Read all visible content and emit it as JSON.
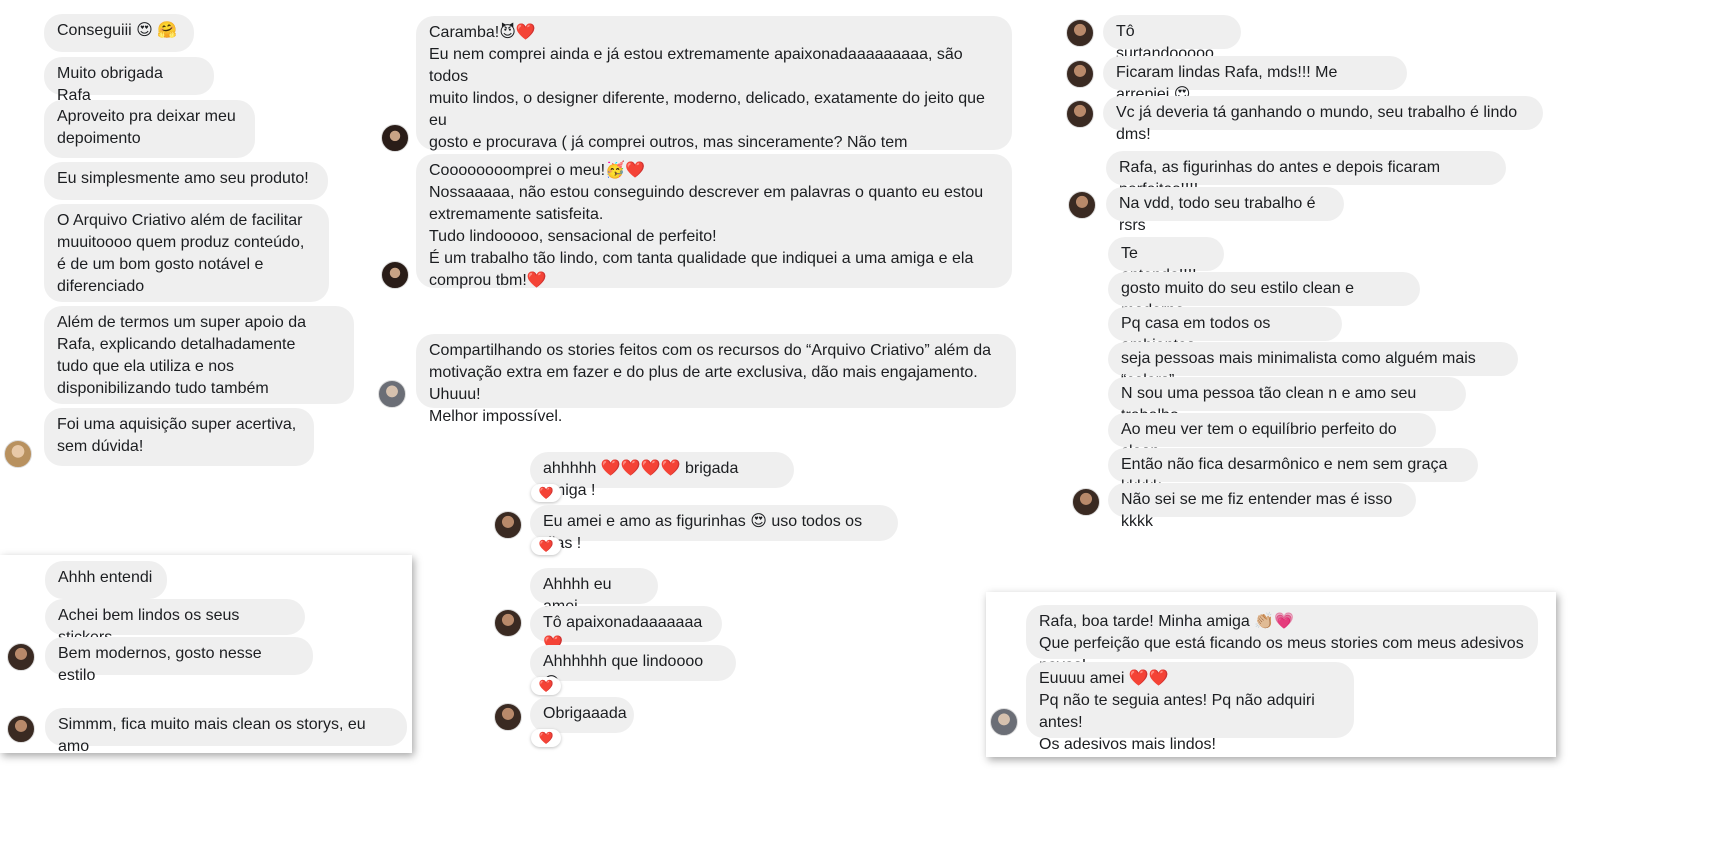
{
  "col1": [
    "Conseguiii 😍 🤗",
    "Muito obrigada Rafa",
    "Aproveito pra deixar meu\ndepoimento",
    "Eu simplesmente amo seu produto!",
    "O Arquivo Criativo além de facilitar\nmuuitoooo quem produz conteúdo,\né de um bom gosto notável e\ndiferenciado",
    "Além de termos um super apoio da\nRafa, explicando detalhadamente\ntudo que ela utiliza e nos\ndisponibilizando tudo também",
    "Foi uma aquisição super acertiva,\nsem dúvida!"
  ],
  "col1b": [
    "Ahhh entendi",
    "Achei bem lindos os seus stickers",
    "Bem modernos, gosto nesse estilo",
    "Simmm, fica muito mais clean os storys, eu amo"
  ],
  "col2": [
    "Caramba!😈❤️\nEu nem comprei ainda e já estou extremamente apaixonadaaaaaaaaa, são todos\nmuito lindos, o designer diferente, moderno, delicado, exatamente do jeito que eu\ngosto e procurava ( já comprei outros, mas sinceramente? Não tem comparação com\na beleza, sutileza e elegância desses que você faz. ) Meus parabéns por entregar um\ntrabalho tão incrível como esse!👏🏼👏🏼❤️🥰",
    "Coooooooomprei o meu!🥳❤️\nNossaaaaa, não estou conseguindo descrever em palavras o quanto eu estou\nextremamente satisfeita.\nTudo lindooooo, sensacional de perfeito!\nÉ um trabalho tão lindo, com tanta qualidade que indiquei a uma amiga e ela\ncomprou tbm!❤️",
    "Compartilhando os stories feitos com os recursos do “Arquivo Criativo” além da\nmotivação extra em fazer e do plus de arte exclusiva, dão mais engajamento. Uhuuu!\nMelhor impossível.",
    "ahhhhh ❤️❤️❤️❤️ brigada amiga !",
    "Eu amei e amo as figurinhas 😍 uso todos os dias !",
    "Ahhhh eu amei",
    "Tô apaixonadaaaaaaa ❤️",
    "Ahhhhhh que lindoooo 😍",
    "Obrigaaada"
  ],
  "col3": [
    "Tô surtandooooo",
    "Ficaram lindas Rafa, mds!!! Me arrepiei 😍",
    "Vc já deveria tá ganhando o mundo, seu trabalho é lindo dms!",
    "Rafa, as figurinhas do antes e depois ficaram perfeitas!!!!",
    "Na vdd, todo seu trabalho é rsrs",
    "Te entendo!!!!",
    "gosto muito do seu estilo clean e moderno",
    "Pq casa em todos os ambientes",
    "seja pessoas mais minimalista como alguém mais “colors”",
    "N sou uma pessoa tão clean n e amo seu trabalho",
    "Ao meu ver tem o equilíbrio perfeito do clean",
    "Então não fica desarmônico e nem sem graça kkkkk",
    "Não sei se me fiz entender mas é isso kkkk"
  ],
  "col3b": [
    "Rafa, boa tarde! Minha amiga 👏🏼💗\nQue perfeição que está ficando os meus stories com meus adesivos novos!",
    "Euuuu amei ❤️❤️\nPq não te seguia antes! Pq não adquiri antes!\nOs adesivos mais lindos!"
  ],
  "reaction": "❤️"
}
